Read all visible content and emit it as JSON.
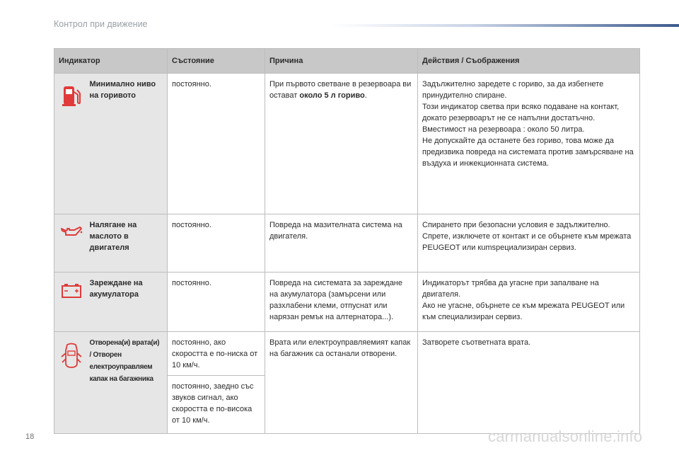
{
  "header": {
    "section_title": "Контрол при движение"
  },
  "table": {
    "headers": [
      "Индикатор",
      "Състояние",
      "Причина",
      "Действия / Съображения"
    ],
    "rows": [
      {
        "icon": "fuel-pump-icon",
        "name": "Минимално ниво на горивото",
        "state": "постоянно.",
        "cause_pre": "При първото светване в резервоара ви остават ",
        "cause_bold": "около 5 л гориво",
        "cause_post": ".",
        "action": "Задължително заредете с гориво, за да избегнете принудително спиране.\nТози индикатор светва при всяко подаване на контакт, докато резервоарът не се напълни достатъчно.\nВместимост на резервоара : около 50 литра.\nНе допускайте да останете без гориво, това може да предизвика повреда на системата против замърсяване на въздуха и инжекционната система."
      },
      {
        "icon": "oil-can-icon",
        "name": "Налягане на маслото в двигателя",
        "state": "постоянно.",
        "cause": "Повреда на мазителната система на двигателя.",
        "action": "Спирането при безопасни условия е задължително.\nСпрете, изключете от контакт и се обърнете към мрежата PEUGEOT или кumspециализиран сервиз."
      },
      {
        "icon": "battery-icon",
        "name": "Зареждане на акумулатора",
        "state": "постоянно.",
        "cause": "Повреда на системата за зареждане на акумулатора (замърсени или разхлабени клеми, отпуснат или нарязан ремък на алтернатора...).",
        "action": "Индикаторът трябва да угасне при запалване на двигателя.\nАко не угасне, обърнете се към мрежата PEUGEOT или към специализиран сервиз."
      },
      {
        "icon": "car-door-open-icon",
        "name": "Отворена(и) врата(и) / Отворен електроуправляем капак на багажника",
        "state": "постоянно, ако скоростта е по-ниска от 10 км/ч.",
        "state2": "постоянно, заедно със звуков сигнал, ако скоростта е по-висока от 10 км/ч.",
        "cause": "Врата или електроуправляемият капак на багажник са останали отворени.",
        "action": "Затворете съответната врата."
      }
    ]
  },
  "footer": {
    "page_number": "18",
    "watermark": "carmanualsonline.info"
  }
}
